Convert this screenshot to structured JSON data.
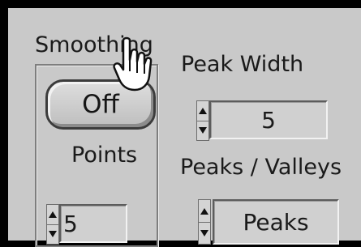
{
  "smoothing": {
    "group_label": "Smoothing",
    "off_button_label": "Off",
    "points_label": "Points",
    "points_value": "5"
  },
  "peak_width": {
    "label": "Peak Width",
    "value": "5"
  },
  "peaks_valleys": {
    "label": "Peaks / Valleys",
    "value": "Peaks"
  },
  "icons": {
    "cursor": "hand-pointer-icon",
    "spin_up": "spin-up-arrow-icon",
    "spin_down": "spin-down-arrow-icon"
  },
  "colors": {
    "panel_background": "#c9c9c9",
    "frame": "#000000"
  }
}
